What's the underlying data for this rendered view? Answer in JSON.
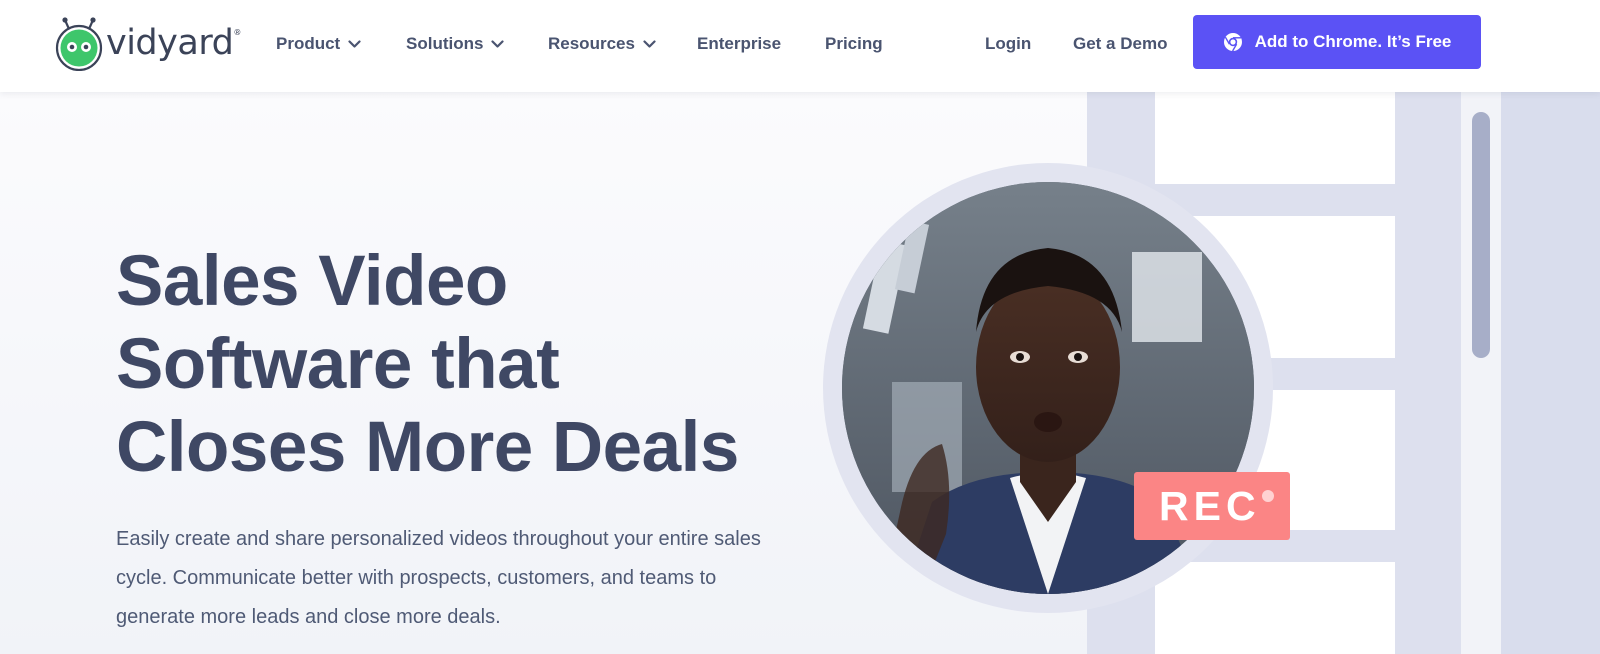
{
  "brand": {
    "name": "vidyard",
    "registered_mark": "®",
    "logo_icon": "robot-logo-icon",
    "accent_green": "#3ec66b"
  },
  "nav": {
    "items": [
      {
        "label": "Product",
        "has_dropdown": true
      },
      {
        "label": "Solutions",
        "has_dropdown": true
      },
      {
        "label": "Resources",
        "has_dropdown": true
      },
      {
        "label": "Enterprise",
        "has_dropdown": false
      },
      {
        "label": "Pricing",
        "has_dropdown": false
      }
    ],
    "dropdown_icon": "chevron-down-icon",
    "login": "Login",
    "demo": "Get a Demo",
    "cta": {
      "label": "Add to Chrome. It’s Free",
      "icon": "chrome-icon",
      "color": "#5b52f5"
    }
  },
  "hero": {
    "headline": "Sales Video Software that Closes More Deals",
    "subtext": "Easily create and share personalized videos throughout your entire sales cycle. Communicate better with prospects, customers, and teams to generate more leads and close more deals.",
    "rec_badge": "REC",
    "rec_color": "#fb8585"
  }
}
